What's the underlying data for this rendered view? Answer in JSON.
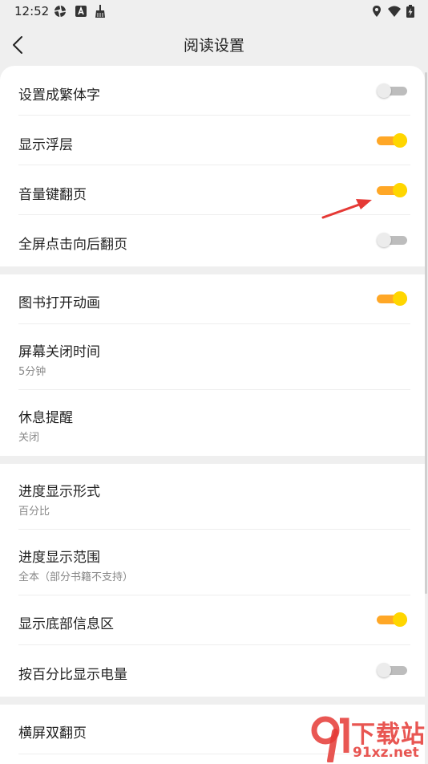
{
  "status": {
    "time": "12:52",
    "icons_left": [
      "aperture-icon",
      "a-badge-icon",
      "broom-icon"
    ],
    "icons_right": [
      "location-icon",
      "wifi-icon",
      "battery-charging-icon"
    ]
  },
  "header": {
    "title": "阅读设置"
  },
  "colors": {
    "toggle_on_track": "#ffa726",
    "toggle_on_knob": "#ffd600",
    "toggle_off_track": "#bdbdbd",
    "arrow": "#e53935"
  },
  "groups": [
    {
      "items": [
        {
          "label": "设置成繁体字",
          "toggle": false
        },
        {
          "label": "显示浮层",
          "toggle": true
        },
        {
          "label": "音量键翻页",
          "toggle": true
        },
        {
          "label": "全屏点击向后翻页",
          "toggle": false
        }
      ]
    },
    {
      "items": [
        {
          "label": "图书打开动画",
          "toggle": true
        },
        {
          "label": "屏幕关闭时间",
          "sub": "5分钟"
        },
        {
          "label": "休息提醒",
          "sub": "关闭"
        }
      ]
    },
    {
      "items": [
        {
          "label": "进度显示形式",
          "sub": "百分比"
        },
        {
          "label": "进度显示范围",
          "sub": "全本（部分书籍不支持）"
        },
        {
          "label": "显示底部信息区",
          "toggle": true
        },
        {
          "label": "按百分比显示电量",
          "toggle": false
        }
      ]
    },
    {
      "items": [
        {
          "label": "横屏双翻页"
        }
      ]
    }
  ],
  "watermark": {
    "text_main": "下载站",
    "text_sub": "91xz.net"
  }
}
